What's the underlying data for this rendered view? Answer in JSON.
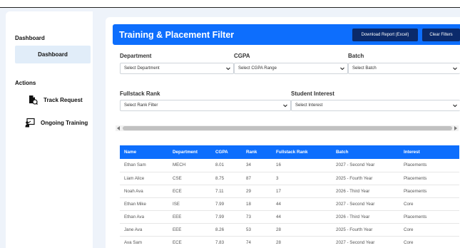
{
  "sidebar": {
    "dashboard_heading": "Dashboard",
    "dashboard_item": "Dashboard",
    "actions_heading": "Actions",
    "items": [
      {
        "label": "Track Request",
        "icon": "track-request-icon"
      },
      {
        "label": "Ongoing Training",
        "icon": "ongoing-training-icon"
      }
    ]
  },
  "header": {
    "title": "Training & Placement Filter",
    "download_label": "Download Report (Excel)",
    "clear_label": "Clear Filters"
  },
  "filters": {
    "department": {
      "label": "Department",
      "value": "Select Department"
    },
    "cgpa": {
      "label": "CGPA",
      "value": "Select CGPA Range"
    },
    "batch": {
      "label": "Batch",
      "value": "Select Batch"
    },
    "rank": {
      "label": "Fullstack Rank",
      "value": "Select Rank Filter"
    },
    "interest": {
      "label": "Student Interest",
      "value": "Select Interest"
    }
  },
  "table": {
    "columns": [
      "Name",
      "Department",
      "CGPA",
      "Rank",
      "Fullstack Rank",
      "Batch",
      "Interest"
    ],
    "rows": [
      [
        "Ethan Sam",
        "MECH",
        "8.01",
        "34",
        "16",
        "2027 - Second Year",
        "Placements"
      ],
      [
        "Liam Alice",
        "CSE",
        "8.75",
        "87",
        "3",
        "2025 - Fourth Year",
        "Placements"
      ],
      [
        "Noah Ava",
        "ECE",
        "7.11",
        "29",
        "17",
        "2026 - Third Year",
        "Placements"
      ],
      [
        "Ethan Mike",
        "ISE",
        "7.99",
        "18",
        "44",
        "2027 - Second Year",
        "Core"
      ],
      [
        "Ethan Ava",
        "EEE",
        "7.99",
        "73",
        "44",
        "2026 - Third Year",
        "Placements"
      ],
      [
        "Jane Ava",
        "EEE",
        "8.26",
        "53",
        "28",
        "2025 - Fourth Year",
        "Core"
      ],
      [
        "Ava Sam",
        "ECE",
        "7.83",
        "74",
        "28",
        "2027 - Second Year",
        "Core"
      ]
    ]
  },
  "colors": {
    "primary": "#0d6efd",
    "button_dark": "#0b2a6b",
    "active_item_bg": "#e1edf9",
    "page_bg": "#eef3fa"
  }
}
